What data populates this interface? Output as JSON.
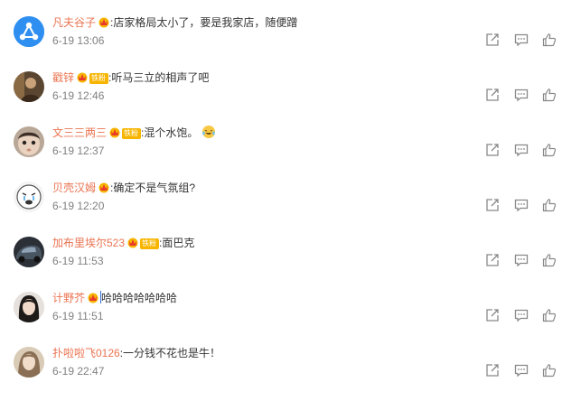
{
  "colors": {
    "username": "#eb7350",
    "timestamp": "#808080",
    "text": "#333333",
    "icon": "#888888",
    "badge": "#f7b500"
  },
  "comments": [
    {
      "username": "凡夫谷子",
      "has_crown": true,
      "badge": "",
      "separator": ":",
      "text": "店家格局太小了，要是我家店，随便蹭",
      "time": "6-19 13:06",
      "avatar_icon": "share-network-icon"
    },
    {
      "username": "戳锌",
      "has_crown": true,
      "badge": "铁粉",
      "separator": ":",
      "text": "听马三立的相声了吧",
      "time": "6-19 12:46",
      "avatar_icon": "person-photo-icon"
    },
    {
      "username": "文三三两三",
      "has_crown": true,
      "badge": "铁粉",
      "separator": ":",
      "text": "混个水饱。",
      "time": "6-19 12:37",
      "avatar_icon": "baby-face-icon",
      "emoji": "laughing-tears-emoji-icon"
    },
    {
      "username": "贝壳汉姆",
      "has_crown": true,
      "badge": "",
      "separator": ":",
      "text": "确定不是气氛组?",
      "time": "6-19 12:20",
      "avatar_icon": "crying-face-icon"
    },
    {
      "username": "加布里埃尔523",
      "has_crown": true,
      "badge": "铁粉",
      "separator": ":",
      "text": "面巴克",
      "time": "6-19 11:53",
      "avatar_icon": "car-photo-icon"
    },
    {
      "username": "计野芥",
      "has_crown": true,
      "badge": "",
      "separator": "",
      "text": "哈哈哈哈哈哈哈",
      "time": "6-19 11:51",
      "avatar_icon": "girl-portrait-icon",
      "caret": true
    },
    {
      "username": "扑啦啦飞0126",
      "has_crown": false,
      "badge": "",
      "separator": ":",
      "text": "一分钱不花也是牛！",
      "time": "6-19 22:47",
      "avatar_icon": "woman-portrait-icon"
    }
  ]
}
